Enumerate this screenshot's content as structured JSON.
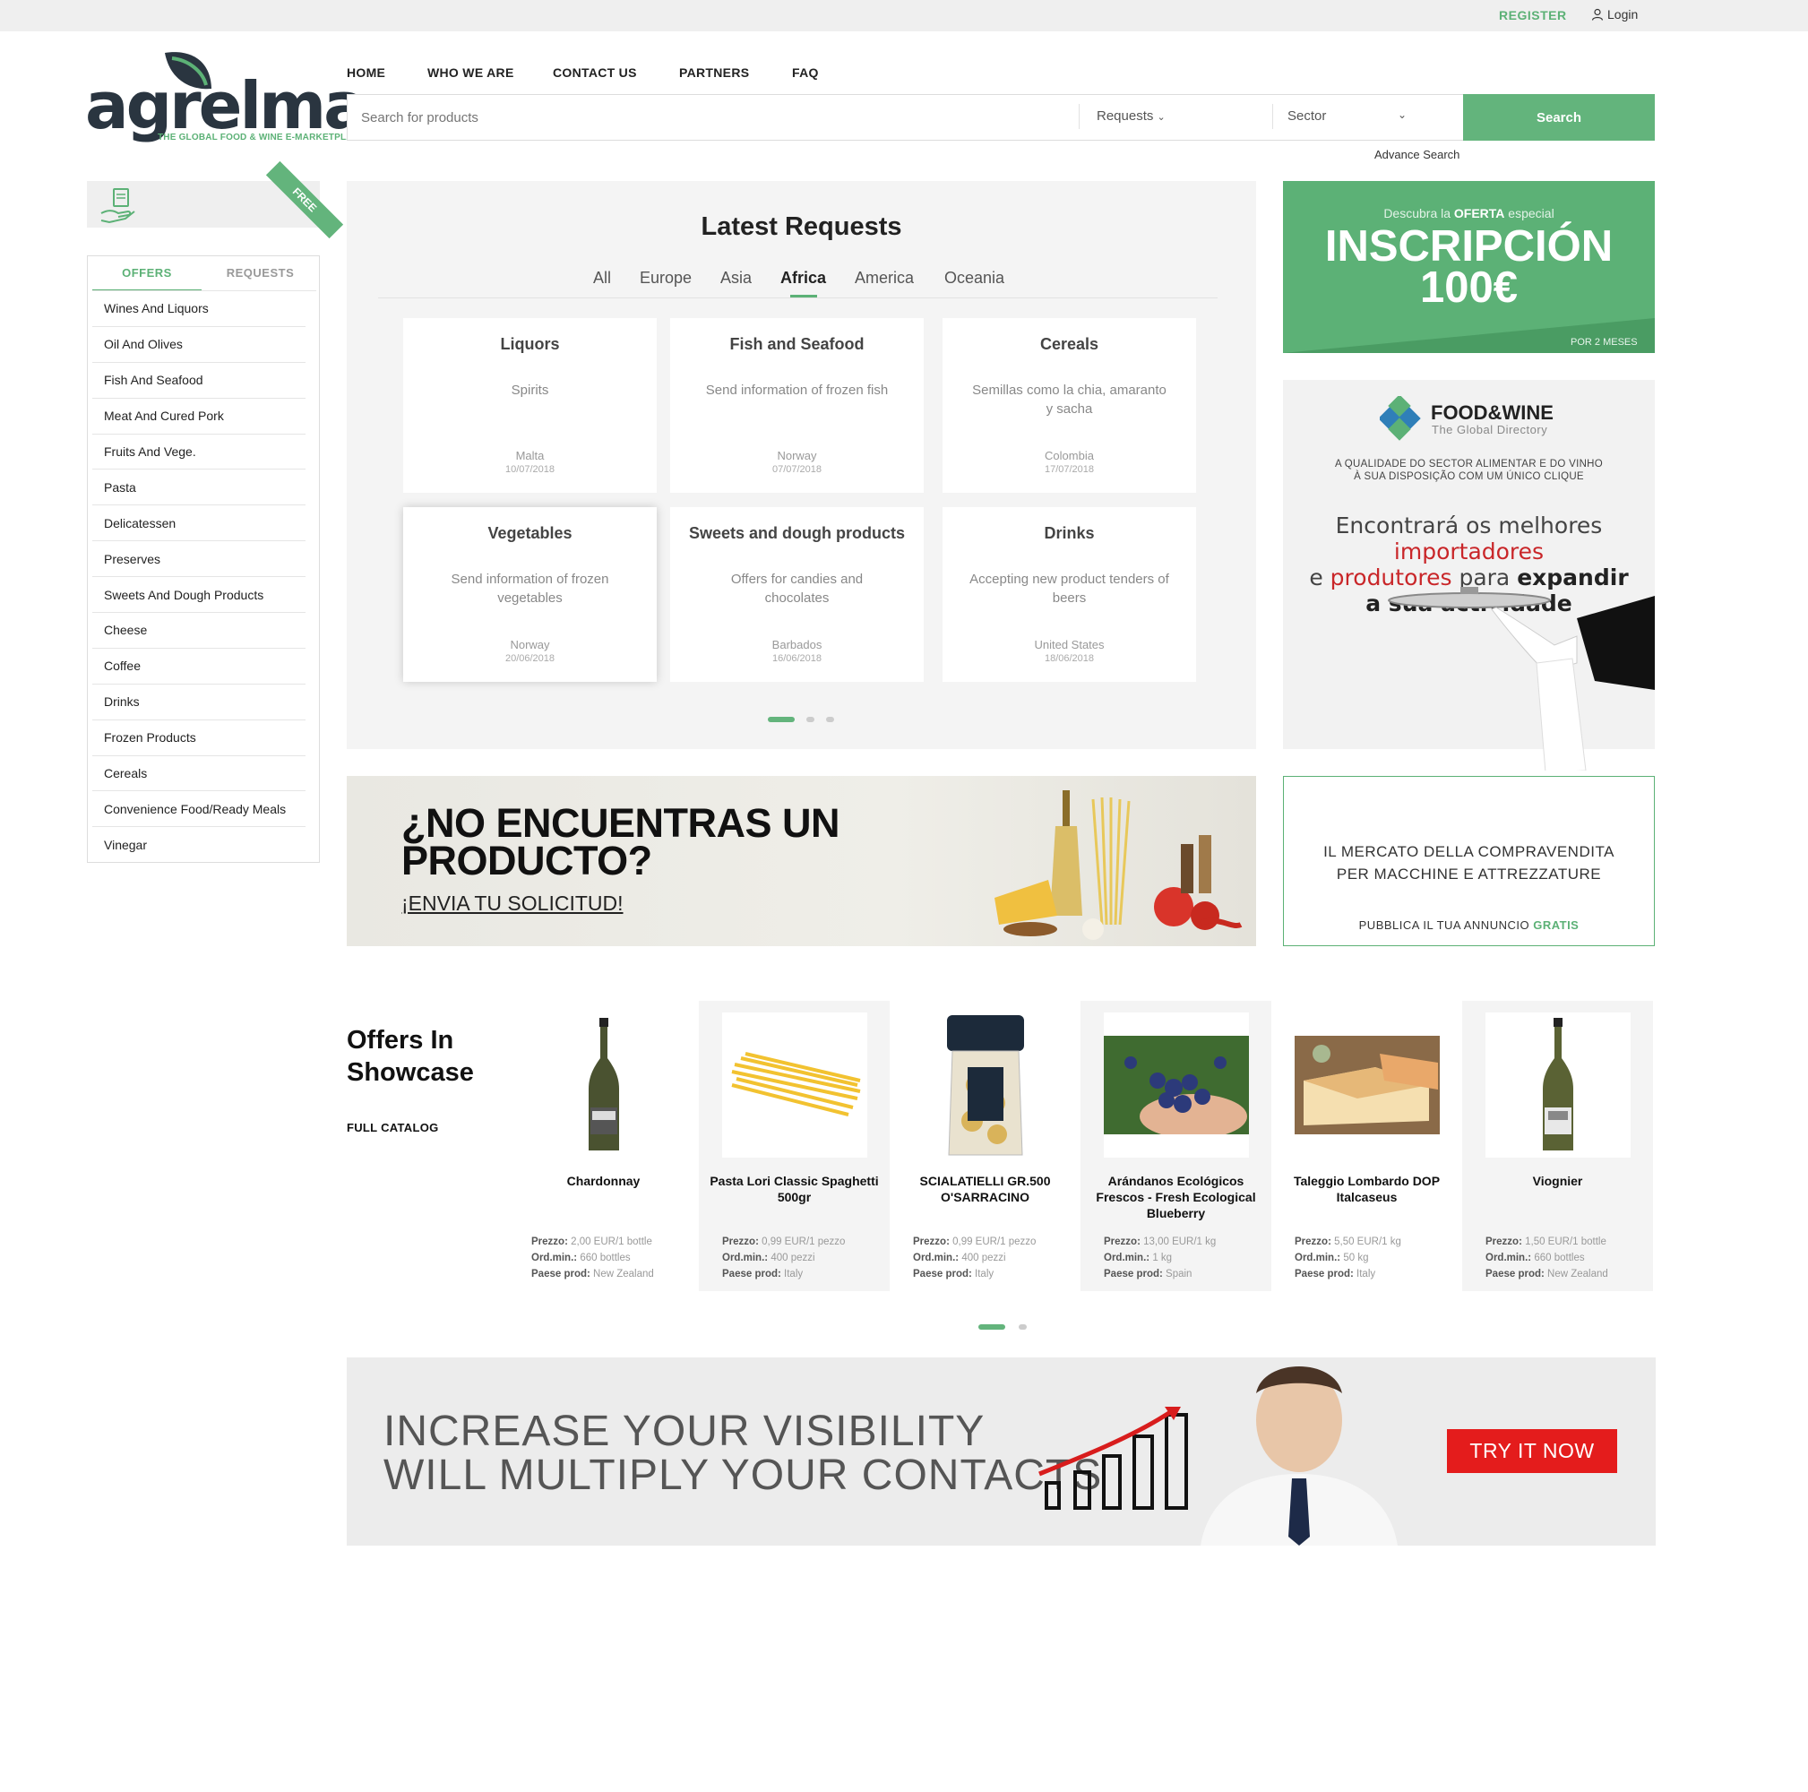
{
  "topbar": {
    "register": "REGISTER",
    "login": "Login"
  },
  "logo": {
    "name": "agrelma",
    "tagline": "THE GLOBAL FOOD & WINE E-MARKETPLACE"
  },
  "nav": [
    "HOME",
    "WHO WE ARE",
    "CONTACT US",
    "PARTNERS",
    "FAQ"
  ],
  "search": {
    "placeholder": "Search for products",
    "type_selected": "Requests",
    "sector_selected": "Sector",
    "button": "Search",
    "advance": "Advance Search"
  },
  "free_badge": "FREE",
  "sidebar": {
    "tabs": [
      "OFFERS",
      "REQUESTS"
    ],
    "active_tab": "OFFERS",
    "categories": [
      "Wines And Liquors",
      "Oil And Olives",
      "Fish And Seafood",
      "Meat And Cured Pork",
      "Fruits And Vege.",
      "Pasta",
      "Delicatessen",
      "Preserves",
      "Sweets And Dough Products",
      "Cheese",
      "Coffee",
      "Drinks",
      "Frozen Products",
      "Cereals",
      "Convenience Food/Ready Meals",
      "Vinegar"
    ]
  },
  "latest_requests": {
    "title": "Latest Requests",
    "regions": [
      "All",
      "Europe",
      "Asia",
      "Africa",
      "America",
      "Oceania"
    ],
    "active_region": "Africa",
    "cards": [
      {
        "title": "Liquors",
        "desc": "Spirits",
        "country": "Malta",
        "date": "10/07/2018"
      },
      {
        "title": "Fish and Seafood",
        "desc": "Send information of frozen fish",
        "country": "Norway",
        "date": "07/07/2018"
      },
      {
        "title": "Cereals",
        "desc": "Semillas como la chia, amaranto y sacha",
        "country": "Colombia",
        "date": "17/07/2018"
      },
      {
        "title": "Vegetables",
        "desc": "Send information of frozen vegetables",
        "country": "Norway",
        "date": "20/06/2018"
      },
      {
        "title": "Sweets and dough products",
        "desc": "Offers for candies and chocolates",
        "country": "Barbados",
        "date": "16/06/2018"
      },
      {
        "title": "Drinks",
        "desc": "Accepting new product tenders of beers",
        "country": "United States",
        "date": "18/06/2018"
      }
    ],
    "pages": 3,
    "active_page": 1
  },
  "banner_inscripcion": {
    "kicker_pre": "Descubra la ",
    "kicker_bold": "OFERTA",
    "kicker_post": " especial",
    "line1": "INSCRIPCIÓN",
    "line2": "100€",
    "foot": "POR 2 MESES"
  },
  "banner_foodwine": {
    "name": "FOOD&WINE",
    "sub": "The Global Directory",
    "line1": "A QUALIDADE DO SECTOR ALIMENTAR E DO VINHO",
    "line2": "À SUA DISPOSIÇÃO COM UM ÚNICO CLIQUE",
    "h1a": "Encontrará os melhores ",
    "h1b": "importadores",
    "h2a": "e ",
    "h2b": "produtores",
    "h2c": " para ",
    "h2d": "expandir",
    "h3": "a sua actividade"
  },
  "banner_noencuentras": {
    "line1": "¿NO ENCUENTRAS UN",
    "line2": "PRODUCTO?",
    "link": "¡ENVIA TU SOLICITUD!"
  },
  "banner_mercato": {
    "line1": "IL MERCATO DELLA COMPRAVENDITA",
    "line2": "PER MACCHINE E ATTREZZATURE",
    "foot_pre": "PUBBLICA IL TUA ANNUNCIO ",
    "foot_bold": "GRATIS"
  },
  "showcase": {
    "title_l1": "Offers In",
    "title_l2": "Showcase",
    "catalog": "FULL CATALOG",
    "label_price": "Prezzo:",
    "label_min": "Ord.min.:",
    "label_country": "Paese prod:",
    "products": [
      {
        "name": "Chardonnay",
        "price": "2,00 EUR/1 bottle",
        "min": "660 bottles",
        "country": "New Zealand",
        "icon": "wine-bottle"
      },
      {
        "name": "Pasta Lori Classic Spaghetti 500gr",
        "price": "0,99 EUR/1 pezzo",
        "min": "400 pezzi",
        "country": "Italy",
        "icon": "spaghetti"
      },
      {
        "name": "SCIALATIELLI GR.500 O'SARRACINO",
        "price": "0,99 EUR/1 pezzo",
        "min": "400 pezzi",
        "country": "Italy",
        "icon": "pasta-bag"
      },
      {
        "name": "Arándanos Ecológicos Frescos - Fresh Ecological Blueberry",
        "price": "13,00 EUR/1 kg",
        "min": "1 kg",
        "country": "Spain",
        "icon": "blueberries"
      },
      {
        "name": "Taleggio Lombardo DOP Italcaseus",
        "price": "5,50 EUR/1 kg",
        "min": "50 kg",
        "country": "Italy",
        "icon": "cheese"
      },
      {
        "name": "Viognier",
        "price": "1,50 EUR/1 bottle",
        "min": "660 bottles",
        "country": "New Zealand",
        "icon": "wine-bottle"
      }
    ],
    "pages": 2,
    "active_page": 1
  },
  "banner_visibility": {
    "line1": "INCREASE YOUR VISIBILITY",
    "line2": "WILL MULTIPLY YOUR CONTACTS",
    "button": "TRY IT NOW"
  },
  "colors": {
    "brand_green": "#63b47c",
    "dark_navy": "#2a3540",
    "cta_red": "#e41c1c"
  }
}
